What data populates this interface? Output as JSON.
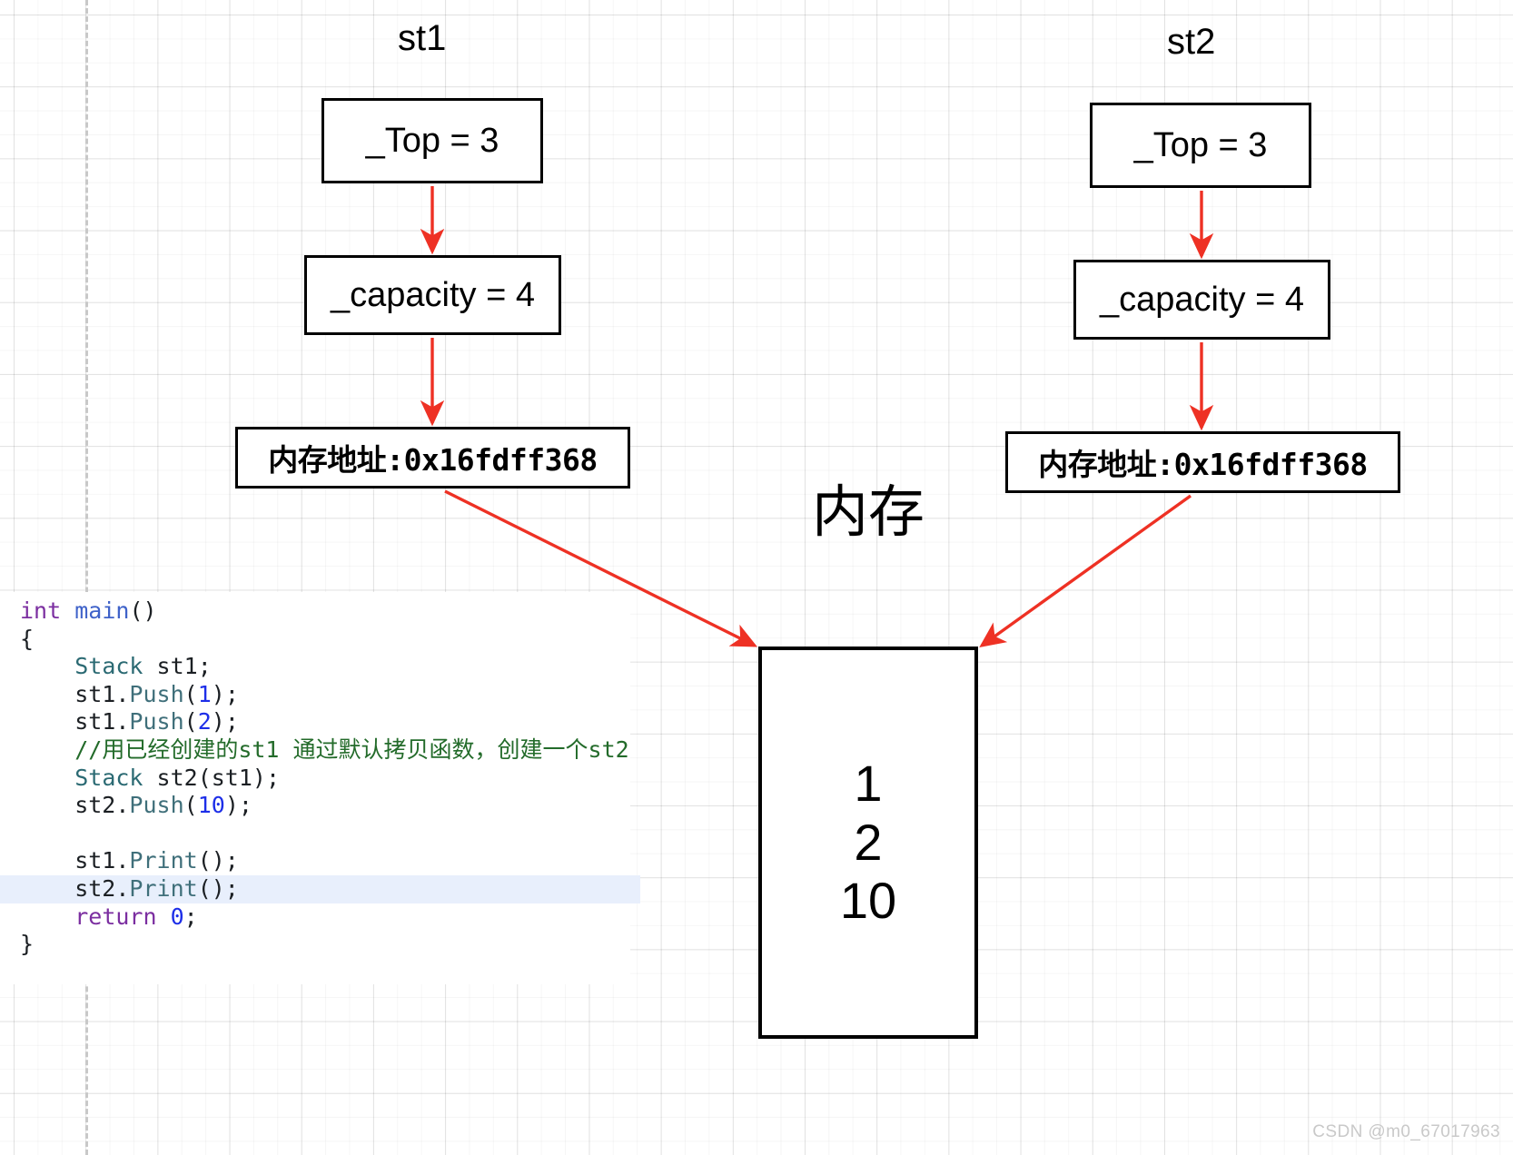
{
  "diagram": {
    "title_hint": "Stack shallow copy memory diagram",
    "accent_arrow_color": "#EE3124",
    "box_border_color": "#000000",
    "groups": [
      {
        "name": "st1",
        "label": "st1",
        "fields": [
          {
            "key": "top",
            "text": "_Top = 3"
          },
          {
            "key": "capacity",
            "text": "_capacity = 4"
          },
          {
            "key": "address",
            "text": "内存地址:0x16fdff368"
          }
        ]
      },
      {
        "name": "st2",
        "label": "st2",
        "fields": [
          {
            "key": "top",
            "text": "_Top = 3"
          },
          {
            "key": "capacity",
            "text": "_capacity = 4"
          },
          {
            "key": "address",
            "text": "内存地址:0x16fdff368"
          }
        ]
      }
    ],
    "memory": {
      "label": "内存",
      "cells": [
        "1",
        "2",
        "10"
      ]
    }
  },
  "code": {
    "language": "cpp",
    "lines": [
      {
        "highlight": false,
        "tokens": [
          {
            "t": "int",
            "c": "t-kw"
          },
          {
            "t": " ",
            "c": "t-plain"
          },
          {
            "t": "main",
            "c": "t-fn"
          },
          {
            "t": "()",
            "c": "t-plain"
          }
        ]
      },
      {
        "highlight": false,
        "tokens": [
          {
            "t": "{",
            "c": "t-plain"
          }
        ]
      },
      {
        "highlight": false,
        "tokens": [
          {
            "t": "    ",
            "c": "t-plain"
          },
          {
            "t": "Stack",
            "c": "t-type"
          },
          {
            "t": " st1;",
            "c": "t-plain"
          }
        ]
      },
      {
        "highlight": false,
        "tokens": [
          {
            "t": "    st1.",
            "c": "t-plain"
          },
          {
            "t": "Push",
            "c": "t-mem"
          },
          {
            "t": "(",
            "c": "t-plain"
          },
          {
            "t": "1",
            "c": "t-num"
          },
          {
            "t": ");",
            "c": "t-plain"
          }
        ]
      },
      {
        "highlight": false,
        "tokens": [
          {
            "t": "    st1.",
            "c": "t-plain"
          },
          {
            "t": "Push",
            "c": "t-mem"
          },
          {
            "t": "(",
            "c": "t-plain"
          },
          {
            "t": "2",
            "c": "t-num"
          },
          {
            "t": ");",
            "c": "t-plain"
          }
        ]
      },
      {
        "highlight": false,
        "tokens": [
          {
            "t": "    ",
            "c": "t-plain"
          },
          {
            "t": "//用已经创建的st1 通过默认拷贝函数，创建一个st2",
            "c": "t-cmt"
          }
        ]
      },
      {
        "highlight": false,
        "tokens": [
          {
            "t": "    ",
            "c": "t-plain"
          },
          {
            "t": "Stack",
            "c": "t-type"
          },
          {
            "t": " st2(st1);",
            "c": "t-plain"
          }
        ]
      },
      {
        "highlight": false,
        "tokens": [
          {
            "t": "    st2.",
            "c": "t-plain"
          },
          {
            "t": "Push",
            "c": "t-mem"
          },
          {
            "t": "(",
            "c": "t-plain"
          },
          {
            "t": "10",
            "c": "t-num"
          },
          {
            "t": ");",
            "c": "t-plain"
          }
        ]
      },
      {
        "highlight": false,
        "tokens": [
          {
            "t": " ",
            "c": "t-plain"
          }
        ]
      },
      {
        "highlight": false,
        "tokens": [
          {
            "t": "    st1.",
            "c": "t-plain"
          },
          {
            "t": "Print",
            "c": "t-mem"
          },
          {
            "t": "();",
            "c": "t-plain"
          }
        ]
      },
      {
        "highlight": true,
        "tokens": [
          {
            "t": "    st2.",
            "c": "t-plain"
          },
          {
            "t": "Print",
            "c": "t-mem"
          },
          {
            "t": "();",
            "c": "t-plain"
          }
        ]
      },
      {
        "highlight": false,
        "tokens": [
          {
            "t": "    ",
            "c": "t-plain"
          },
          {
            "t": "return",
            "c": "t-kw"
          },
          {
            "t": " ",
            "c": "t-plain"
          },
          {
            "t": "0",
            "c": "t-num"
          },
          {
            "t": ";",
            "c": "t-plain"
          }
        ]
      },
      {
        "highlight": false,
        "tokens": [
          {
            "t": "}",
            "c": "t-plain"
          }
        ]
      }
    ]
  },
  "watermark": {
    "text": "CSDN @m0_67017963"
  }
}
